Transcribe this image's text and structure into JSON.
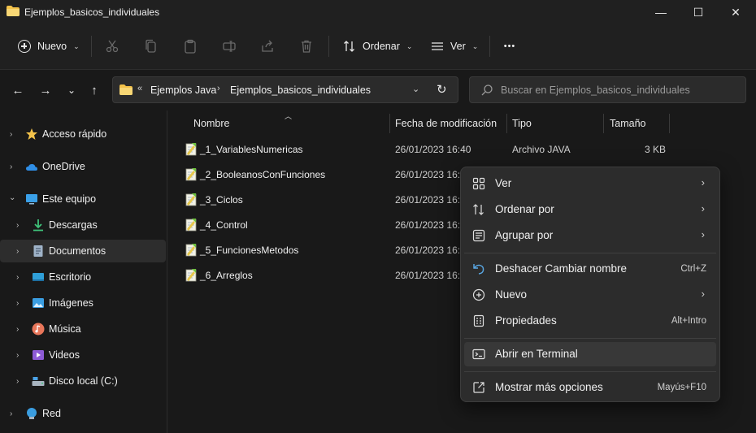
{
  "window": {
    "title": "Ejemplos_basicos_individuales",
    "min": "—",
    "max": "☐",
    "close": "✕"
  },
  "toolbar": {
    "new_label": "Nuevo",
    "sort_label": "Ordenar",
    "view_label": "Ver",
    "more": "•••"
  },
  "address": {
    "overflow": "«",
    "crumbs": [
      "Ejemplos Java",
      "Ejemplos_basicos_individuales"
    ]
  },
  "search": {
    "placeholder": "Buscar en Ejemplos_basicos_individuales"
  },
  "sidebar": {
    "items": [
      {
        "label": "Acceso rápido",
        "icon": "star-icon"
      },
      {
        "label": "OneDrive",
        "icon": "cloud-icon"
      },
      {
        "label": "Este equipo",
        "icon": "monitor-icon"
      },
      {
        "label": "Descargas",
        "icon": "download-icon"
      },
      {
        "label": "Documentos",
        "icon": "document-icon"
      },
      {
        "label": "Escritorio",
        "icon": "desktop-icon"
      },
      {
        "label": "Imágenes",
        "icon": "image-icon"
      },
      {
        "label": "Música",
        "icon": "music-icon"
      },
      {
        "label": "Videos",
        "icon": "video-icon"
      },
      {
        "label": "Disco local (C:)",
        "icon": "drive-icon"
      },
      {
        "label": "Red",
        "icon": "network-icon"
      }
    ]
  },
  "columns": {
    "name": "Nombre",
    "date": "Fecha de modificación",
    "type": "Tipo",
    "size": "Tamaño"
  },
  "files": [
    {
      "name": "_1_VariablesNumericas",
      "date": "26/01/2023 16:40",
      "type": "Archivo JAVA",
      "size": "3 KB"
    },
    {
      "name": "_2_BooleanosConFunciones",
      "date": "26/01/2023 16:4",
      "type": "",
      "size": ""
    },
    {
      "name": "_3_Ciclos",
      "date": "26/01/2023 16:4",
      "type": "",
      "size": ""
    },
    {
      "name": "_4_Control",
      "date": "26/01/2023 16:4",
      "type": "",
      "size": ""
    },
    {
      "name": "_5_FuncionesMetodos",
      "date": "26/01/2023 16:4",
      "type": "",
      "size": ""
    },
    {
      "name": "_6_Arreglos",
      "date": "26/01/2023 16:4",
      "type": "",
      "size": ""
    }
  ],
  "context_menu": {
    "items": [
      {
        "label": "Ver",
        "shortcut": "",
        "submenu": true
      },
      {
        "label": "Ordenar por",
        "shortcut": "",
        "submenu": true
      },
      {
        "label": "Agrupar por",
        "shortcut": "",
        "submenu": true
      },
      {
        "label": "Deshacer Cambiar nombre",
        "shortcut": "Ctrl+Z",
        "submenu": false
      },
      {
        "label": "Nuevo",
        "shortcut": "",
        "submenu": true
      },
      {
        "label": "Propiedades",
        "shortcut": "Alt+Intro",
        "submenu": false
      },
      {
        "label": "Abrir en Terminal",
        "shortcut": "",
        "submenu": false
      },
      {
        "label": "Mostrar más opciones",
        "shortcut": "Mayús+F10",
        "submenu": false
      }
    ]
  },
  "colors": {
    "background": "#191919",
    "chrome": "#202020",
    "menu": "#2c2c2c",
    "folder": "#f3c24a",
    "accent": "#60cdff"
  }
}
